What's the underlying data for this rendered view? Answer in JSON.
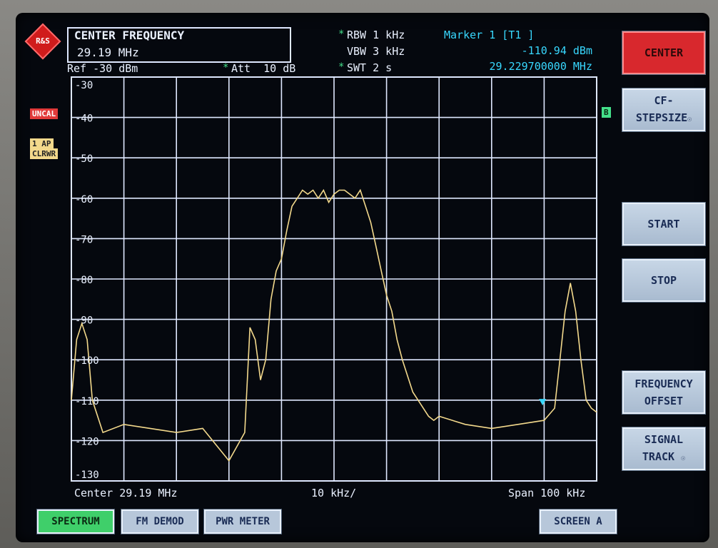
{
  "header": {
    "logo_text": "R&S",
    "center_freq_title": "CENTER FREQUENCY",
    "center_freq_value": "29.19 MHz",
    "ref_level": "Ref -30 dBm",
    "att": "Att  10 dB",
    "rbw": "RBW 1 kHz",
    "vbw": "VBW 3 kHz",
    "swt": "SWT 2 s",
    "marker_title": "Marker 1 [T1 ]",
    "marker_level": "-110.94 dBm",
    "marker_freq": "29.229700000 MHz",
    "star_mark": "*"
  },
  "side_tags": {
    "uncal": "UNCAL",
    "trace_mode_1": "1 AP",
    "trace_mode_2": "CLRWR",
    "b_tag": "B"
  },
  "footer": {
    "center": "Center 29.19 MHz",
    "div": "10 kHz/",
    "span": "Span 100 kHz"
  },
  "softkeys": {
    "center": "CENTER",
    "cf_stepsize_1": "CF-",
    "cf_stepsize_2": "STEPSIZE",
    "start": "START",
    "stop": "STOP",
    "freq_offset_1": "FREQUENCY",
    "freq_offset_2": "OFFSET",
    "signal_track_1": "SIGNAL",
    "signal_track_2": "TRACK",
    "more_glyph": "☉"
  },
  "mode_keys": {
    "spectrum": "SPECTRUM",
    "fm_demod": "FM DEMOD",
    "pwr_meter": "PWR METER",
    "screen_a": "SCREEN A"
  },
  "colors": {
    "trace": "#f3d98c",
    "grid": "#dfe8ff",
    "marker_text": "#38d8ff",
    "softkey_active": "#d8282d"
  },
  "chart_data": {
    "type": "line",
    "title": "",
    "xlabel": "",
    "ylabel": "",
    "x_unit": "kHz offset from center",
    "xlim": [
      -50,
      50
    ],
    "ylim": [
      -130,
      -30
    ],
    "y_ticks": [
      "-30",
      "-40",
      "-50",
      "-60",
      "-70",
      "-80",
      "-90",
      "-100",
      "-110",
      "-120",
      "-130"
    ],
    "grid": true,
    "series": [
      {
        "x": [
          -50,
          -49,
          -48,
          -47,
          -46,
          -44,
          -40,
          -35,
          -30,
          -25,
          -20,
          -17,
          -16,
          -15,
          -14,
          -13,
          -12,
          -11,
          -10,
          -9,
          -8,
          -7,
          -6,
          -5,
          -4,
          -3,
          -2,
          -1,
          0,
          1,
          2,
          3,
          4,
          5,
          6,
          7,
          8,
          9,
          10,
          11,
          12,
          13,
          14,
          15,
          16,
          17,
          18,
          19,
          20,
          25,
          30,
          35,
          40,
          42,
          43,
          44,
          45,
          46,
          47,
          48,
          49,
          50
        ],
        "y": [
          -110,
          -95,
          -91,
          -95,
          -110,
          -118,
          -116,
          -117,
          -118,
          -117,
          -125,
          -118,
          -92,
          -95,
          -105,
          -100,
          -85,
          -78,
          -75,
          -68,
          -62,
          -60,
          -58,
          -59,
          -58,
          -60,
          -58,
          -61,
          -59,
          -58,
          -58,
          -59,
          -60,
          -58,
          -62,
          -66,
          -72,
          -78,
          -84,
          -88,
          -95,
          -100,
          -104,
          -108,
          -110,
          -112,
          -114,
          -115,
          -114,
          -116,
          -117,
          -116,
          -115,
          -112,
          -100,
          -88,
          -81,
          -88,
          -100,
          -110,
          -112,
          -113
        ]
      }
    ],
    "marker": {
      "x": 39.7,
      "y": -110.94
    }
  }
}
